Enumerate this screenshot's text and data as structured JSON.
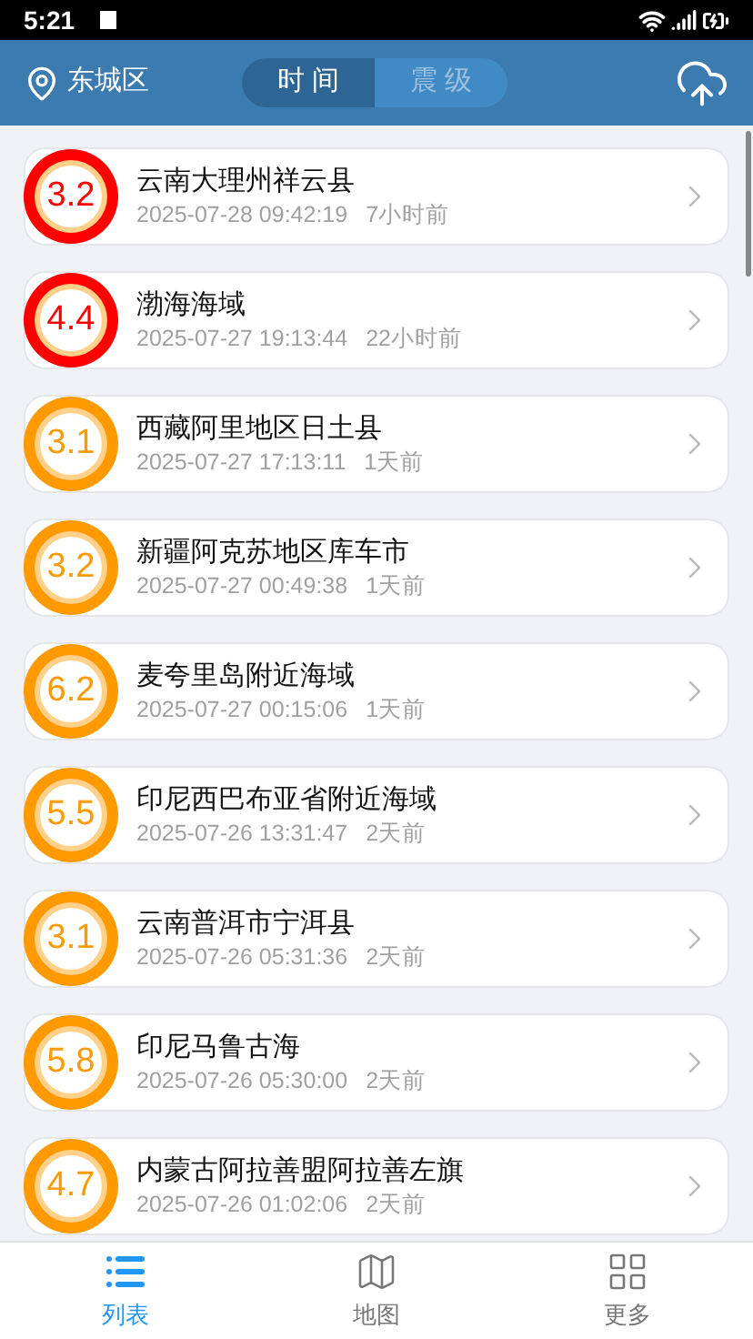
{
  "status_bar": {
    "time": "5:21"
  },
  "header": {
    "location": "东城区",
    "tabs": [
      {
        "label": "时 间",
        "selected": true
      },
      {
        "label": "震 级",
        "selected": false
      }
    ]
  },
  "quakes": [
    {
      "magnitude": "3.2",
      "place": "云南大理州祥云县",
      "time": "2025-07-28 09:42:19",
      "ago": "7小时前",
      "color": "#ff0000"
    },
    {
      "magnitude": "4.4",
      "place": "渤海海域",
      "time": "2025-07-27 19:13:44",
      "ago": "22小时前",
      "color": "#ff0000"
    },
    {
      "magnitude": "3.1",
      "place": "西藏阿里地区日土县",
      "time": "2025-07-27 17:13:11",
      "ago": "1天前",
      "color": "#ff9900"
    },
    {
      "magnitude": "3.2",
      "place": "新疆阿克苏地区库车市",
      "time": "2025-07-27 00:49:38",
      "ago": "1天前",
      "color": "#ff9900"
    },
    {
      "magnitude": "6.2",
      "place": "麦夸里岛附近海域",
      "time": "2025-07-27 00:15:06",
      "ago": "1天前",
      "color": "#ff9900"
    },
    {
      "magnitude": "5.5",
      "place": "印尼西巴布亚省附近海域",
      "time": "2025-07-26 13:31:47",
      "ago": "2天前",
      "color": "#ff9900"
    },
    {
      "magnitude": "3.1",
      "place": "云南普洱市宁洱县",
      "time": "2025-07-26 05:31:36",
      "ago": "2天前",
      "color": "#ff9900"
    },
    {
      "magnitude": "5.8",
      "place": "印尼马鲁古海",
      "time": "2025-07-26 05:30:00",
      "ago": "2天前",
      "color": "#ff9900"
    },
    {
      "magnitude": "4.7",
      "place": "内蒙古阿拉善盟阿拉善左旗",
      "time": "2025-07-26 01:02:06",
      "ago": "2天前",
      "color": "#ff9900"
    }
  ],
  "bottom_nav": [
    {
      "label": "列表",
      "kind": "list",
      "selected": true
    },
    {
      "label": "地图",
      "kind": "map",
      "selected": false
    },
    {
      "label": "更多",
      "kind": "grid",
      "selected": false
    }
  ]
}
